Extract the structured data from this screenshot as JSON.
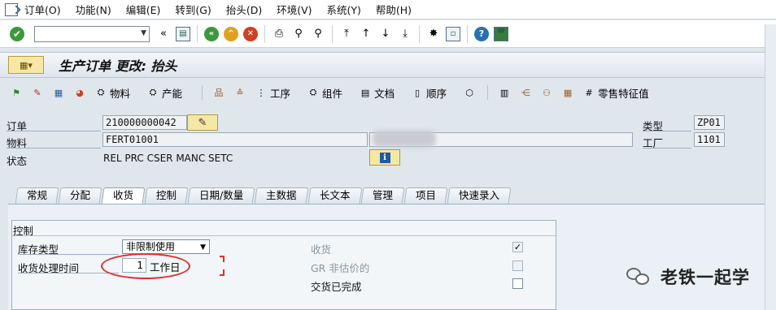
{
  "menu": [
    "订单(O)",
    "功能(N)",
    "编辑(E)",
    "转到(G)",
    "抬头(D)",
    "环境(V)",
    "系统(Y)",
    "帮助(H)"
  ],
  "toolbar": {
    "command_value": ""
  },
  "title": "生产订单 更改: 抬头",
  "app_toolbar": {
    "material": "物料",
    "capacity": "产能",
    "operations": "工序",
    "components": "组件",
    "documents": "文档",
    "sequences": "顺序",
    "retail_char": "零售特征值"
  },
  "header": {
    "order_label": "订单",
    "order_value": "210000000042",
    "material_label": "物料",
    "material_value": "FERT01001",
    "status_label": "状态",
    "status_value": "REL  PRC  CSER MANC SETC",
    "type_label": "类型",
    "type_value": "ZP01",
    "plant_label": "工厂",
    "plant_value": "1101"
  },
  "tabs": [
    "常规",
    "分配",
    "收货",
    "控制",
    "日期/数量",
    "主数据",
    "长文本",
    "管理",
    "项目",
    "快速录入"
  ],
  "active_tab": "收货",
  "control": {
    "group_title": "控制",
    "stock_type_label": "库存类型",
    "stock_type_value": "非限制使用",
    "gr_proc_time_label": "收货处理时间",
    "gr_proc_time_value": "1",
    "gr_proc_time_unit": "工作日",
    "goods_receipt_label": "收货",
    "goods_receipt_checked": true,
    "gr_nonvaluated_label": "GR 非估价的",
    "gr_nonvaluated_checked": false,
    "delivery_completed_label": "交货已完成",
    "delivery_completed_checked": false
  },
  "watermark": "老铁一起学"
}
